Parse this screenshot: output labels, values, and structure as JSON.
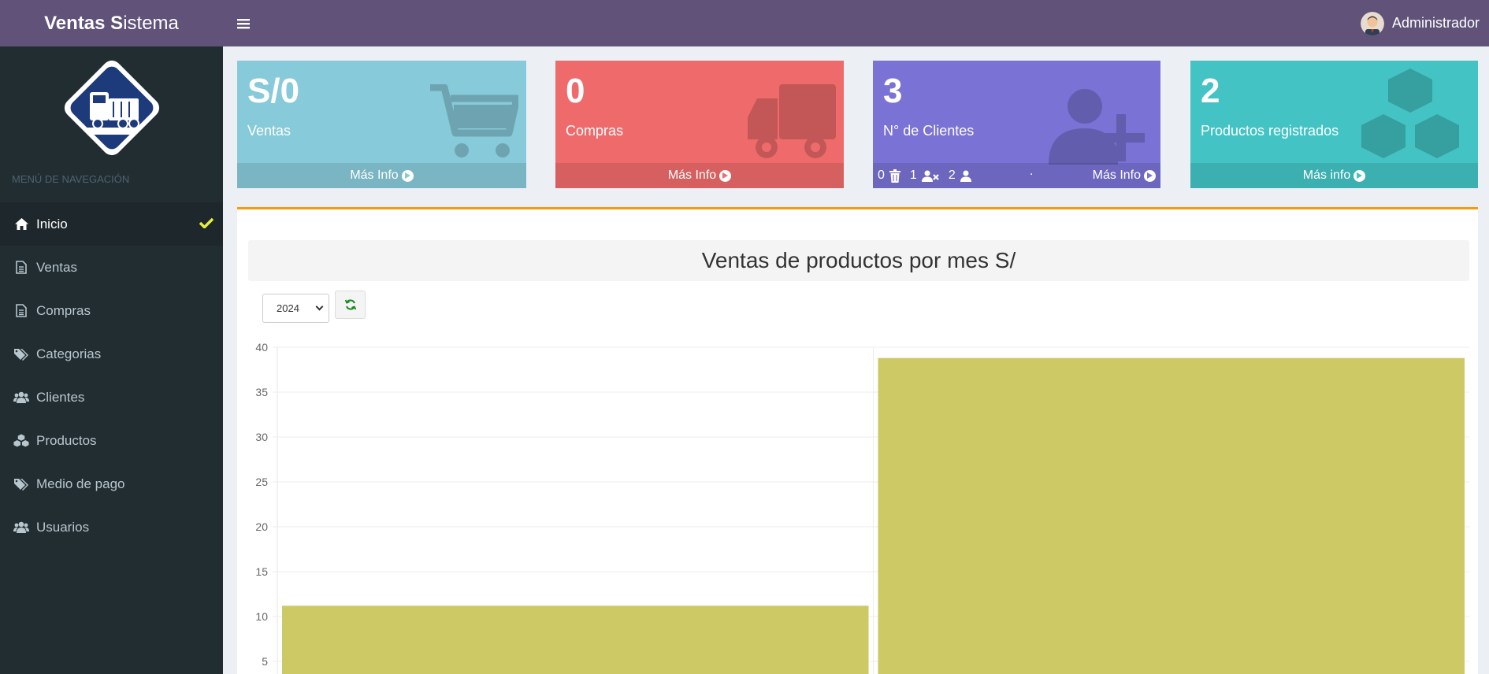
{
  "header": {
    "brand_bold": "Ventas S",
    "brand_rest": "istema",
    "user_name": "Administrador"
  },
  "sidebar": {
    "nav_header": "MENÚ DE NAVEGACIÓN",
    "items": [
      {
        "label": "Inicio",
        "icon": "home-icon",
        "active": true
      },
      {
        "label": "Ventas",
        "icon": "file-icon"
      },
      {
        "label": "Compras",
        "icon": "file-icon"
      },
      {
        "label": "Categorias",
        "icon": "tags-icon"
      },
      {
        "label": "Clientes",
        "icon": "users-icon"
      },
      {
        "label": "Productos",
        "icon": "cubes-icon"
      },
      {
        "label": "Medio de pago",
        "icon": "tags-icon"
      },
      {
        "label": "Usuarios",
        "icon": "users-icon"
      }
    ]
  },
  "boxes": {
    "ventas": {
      "value": "S/0",
      "label": "Ventas",
      "link": "Más Info",
      "color": "#87cad9"
    },
    "compras": {
      "value": "0",
      "label": "Compras",
      "link": "Más Info",
      "color": "#ef6b6b"
    },
    "clientes": {
      "value": "3",
      "label": "N° de Clientes",
      "link": "Más Info",
      "deleted": "0",
      "inactive": "1",
      "active": "2",
      "dot": ".",
      "color": "#7a72d5"
    },
    "productos": {
      "value": "2",
      "label": "Productos registrados",
      "link": "Más info",
      "color": "#43c3c4"
    }
  },
  "panel": {
    "title": "Ventas de productos por mes S/",
    "year": "2024",
    "accent": "#f39c12"
  },
  "chart_data": {
    "type": "bar",
    "categories": [
      "",
      ""
    ],
    "values": [
      11.2,
      38.8
    ],
    "ylim": [
      0,
      40
    ],
    "yticks": [
      5,
      10,
      15,
      20,
      25,
      30,
      35,
      40
    ],
    "grid": true,
    "bar_color": "#cdc964"
  }
}
